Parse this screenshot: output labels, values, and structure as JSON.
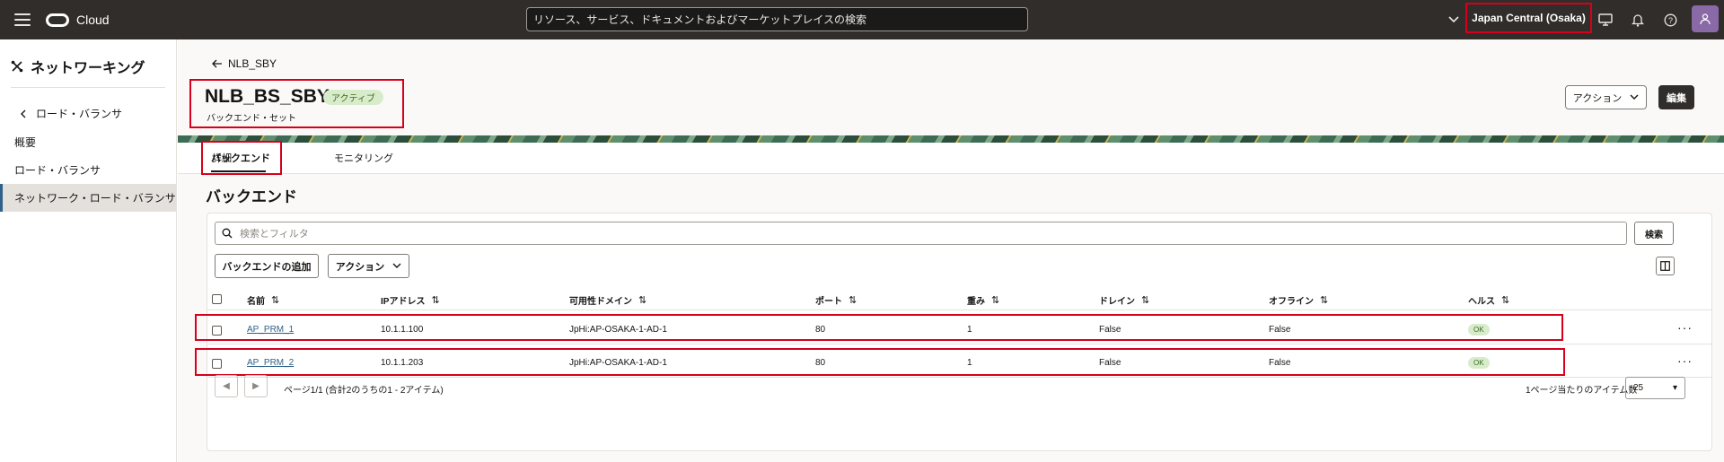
{
  "topbar": {
    "brand": "Cloud",
    "search_placeholder": "リソース、サービス、ドキュメントおよびマーケットプレイスの検索",
    "region": "Japan Central (Osaka)"
  },
  "sidebar": {
    "title": "ネットワーキング",
    "back_label": "ロード・バランサ",
    "items": [
      {
        "label": "概要"
      },
      {
        "label": "ロード・バランサ"
      },
      {
        "label": "ネットワーク・ロード・バランサ"
      }
    ]
  },
  "header": {
    "breadcrumb": "NLB_SBY",
    "title": "NLB_BS_SBY",
    "status": "アクティブ",
    "subtitle": "バックエンド・セット",
    "actions_label": "アクション",
    "edit_label": "編集"
  },
  "tabs": [
    {
      "label": "詳細"
    },
    {
      "label": "バックエンド"
    },
    {
      "label": "モニタリング"
    }
  ],
  "section": {
    "title": "バックエンド",
    "filter_placeholder": "検索とフィルタ",
    "search_label": "検索",
    "add_label": "バックエンドの追加",
    "actions_label": "アクション"
  },
  "table": {
    "columns": [
      "名前",
      "IPアドレス",
      "可用性ドメイン",
      "ポート",
      "重み",
      "ドレイン",
      "オフライン",
      "ヘルス"
    ],
    "rows": [
      {
        "name": "AP_PRM_1",
        "ip": "10.1.1.100",
        "ad": "JpHi:AP-OSAKA-1-AD-1",
        "port": "80",
        "weight": "1",
        "drain": "False",
        "offline": "False",
        "health": "OK"
      },
      {
        "name": "AP_PRM_2",
        "ip": "10.1.1.203",
        "ad": "JpHi:AP-OSAKA-1-AD-1",
        "port": "80",
        "weight": "1",
        "drain": "False",
        "offline": "False",
        "health": "OK"
      }
    ]
  },
  "pager": {
    "summary": "ページ1/1 (合計2のうちの1 - 2アイテム)",
    "per_page_label": "1ページ当たりのアイテム数",
    "per_page_value": "25"
  },
  "colors": {
    "accent": "#d6001c",
    "topbar": "#312d2a",
    "link": "#2f6189",
    "ok": "#d8eccb"
  },
  "icons": [
    "menu-icon",
    "oracle-logo-icon",
    "chevron-down-icon",
    "cloud-shell-icon",
    "bell-icon",
    "help-icon",
    "user-icon",
    "network-icon",
    "back-arrow-icon",
    "search-icon",
    "columns-icon",
    "more-icon",
    "sort-icon"
  ]
}
